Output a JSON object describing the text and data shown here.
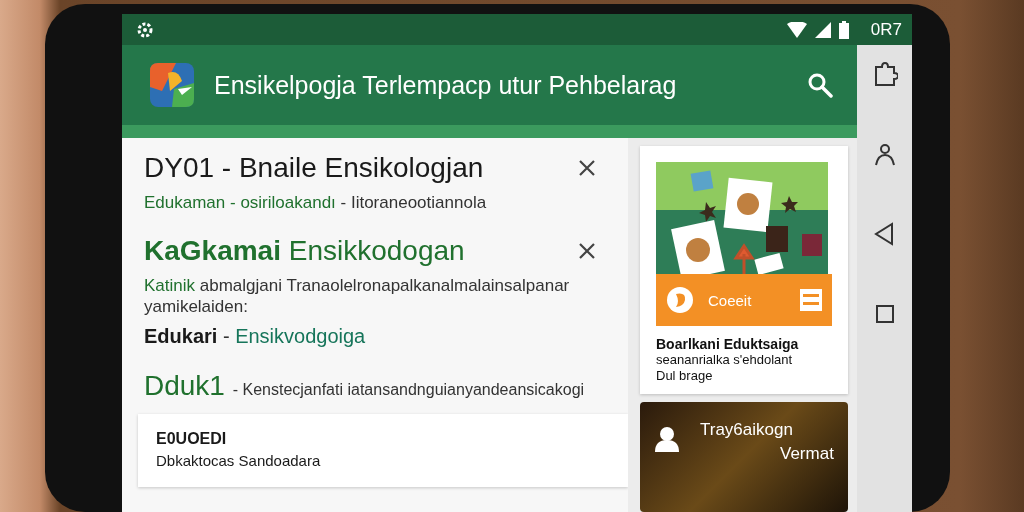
{
  "status_bar": {
    "time": "0R7"
  },
  "app_bar": {
    "title": "Ensikelpogja Terlempacp utur Pehbelarag"
  },
  "list": [
    {
      "kind": "entry",
      "closable": true,
      "title": [
        {
          "text": "DY01 - Bnaile Ensikologjan",
          "color": "#1a1a1a",
          "bold": false
        }
      ],
      "lines": [
        [
          {
            "text": "Edukaman - osiriloakandı",
            "color": "#20712e",
            "bold": false
          },
          {
            "text": "- Iitoraneootiannola",
            "color": "#333333",
            "bold": false
          }
        ]
      ]
    },
    {
      "kind": "entry",
      "closable": true,
      "title": [
        {
          "text": "KaGkamai",
          "color": "#20712e",
          "bold": true
        },
        {
          "text": "Ensikkodogan",
          "color": "#20712e",
          "bold": false
        }
      ],
      "lines": [
        [
          {
            "text": "Katinik",
            "color": "#20712e",
            "bold": false
          },
          {
            "text": "abmalgjani Tranaolelronapalkanalmalainsalpanar yamikelaiden:",
            "color": "#333333",
            "bold": false
          }
        ]
      ],
      "tagline": [
        {
          "text": "Edukari",
          "color": "#1a1a1a",
          "bold": true
        },
        {
          "text": "-",
          "color": "#333333",
          "bold": false
        },
        {
          "text": "Ensikvodgoiga",
          "color": "#16755a",
          "bold": false
        }
      ]
    },
    {
      "kind": "entry",
      "closable": false,
      "title": [
        {
          "text": "Dduk1",
          "color": "#20712e",
          "bold": false
        }
      ],
      "title_note": "- Kenstecjanfati iatansandnguianyandeansicakogi"
    },
    {
      "kind": "card",
      "closable": false,
      "title": [
        {
          "text": "E0UOEDI",
          "color": "#1a1a1a",
          "bold": true
        }
      ],
      "lines": [
        [
          {
            "text": "Dbkaktocas Sandoadara",
            "color": "#1a1a1a",
            "bold": false
          }
        ]
      ]
    }
  ],
  "side_cards": [
    {
      "kind": "illustrated",
      "action": "Coeeit",
      "caption": [
        "Boarlkani Eduktsaiga",
        "seananrialka s'ehdolant",
        "Dul brage"
      ]
    },
    {
      "kind": "photo",
      "lines": [
        "Tray6aikogn",
        "Vermat"
      ]
    }
  ]
}
